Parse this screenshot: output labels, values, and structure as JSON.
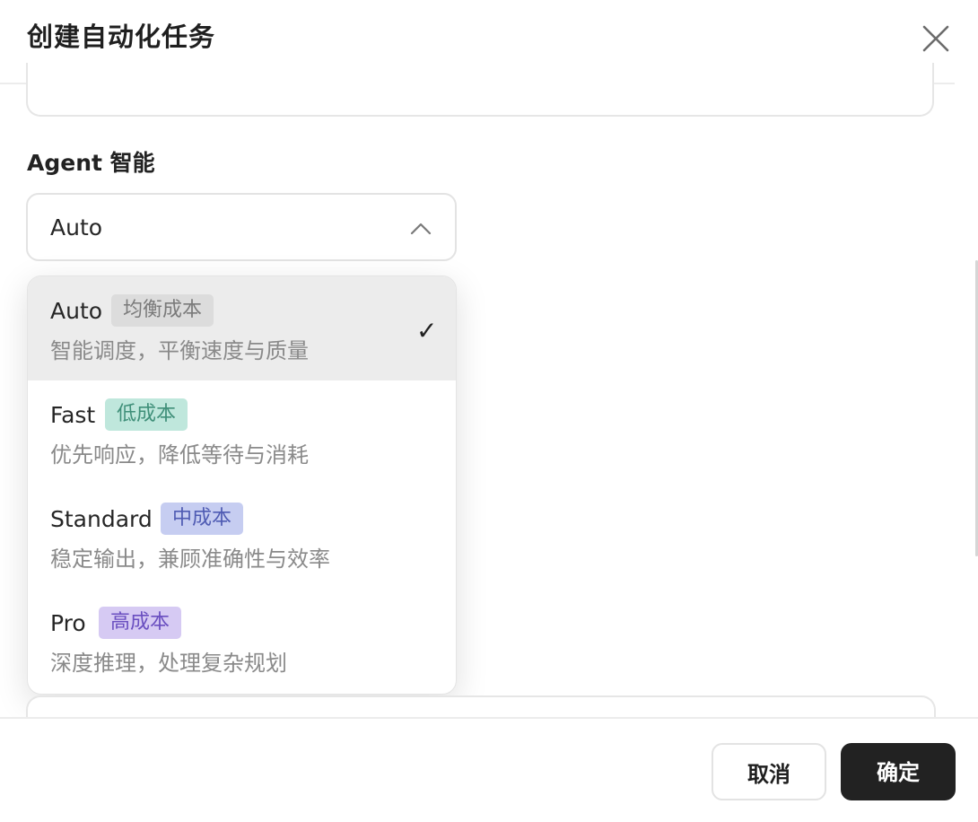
{
  "dialog": {
    "title": "创建自动化任务",
    "close_icon": "close-icon"
  },
  "agent_field": {
    "label": "Agent 智能",
    "selected_value": "Auto",
    "chevron_icon": "chevron-up-icon",
    "options": [
      {
        "name": "Auto",
        "badge": "均衡成本",
        "description": "智能调度，平衡速度与质量",
        "selected": true,
        "badge_bg": "#dcdcdc",
        "badge_fg": "#7a7a7a"
      },
      {
        "name": "Fast",
        "badge": "低成本",
        "description": "优先响应，降低等待与消耗",
        "selected": false,
        "badge_bg": "#bfe7dc",
        "badge_fg": "#3f8f79"
      },
      {
        "name": "Standard",
        "badge": "中成本",
        "description": "稳定输出，兼顾准确性与效率",
        "selected": false,
        "badge_bg": "#c6cdf1",
        "badge_fg": "#4f5bb3"
      },
      {
        "name": "Pro",
        "badge": "高成本",
        "description": "深度推理，处理复杂规划",
        "selected": false,
        "badge_bg": "#d6caf3",
        "badge_fg": "#6a4fc0"
      }
    ],
    "check_mark": "✓"
  },
  "footer": {
    "cancel_label": "取消",
    "confirm_label": "确定"
  }
}
